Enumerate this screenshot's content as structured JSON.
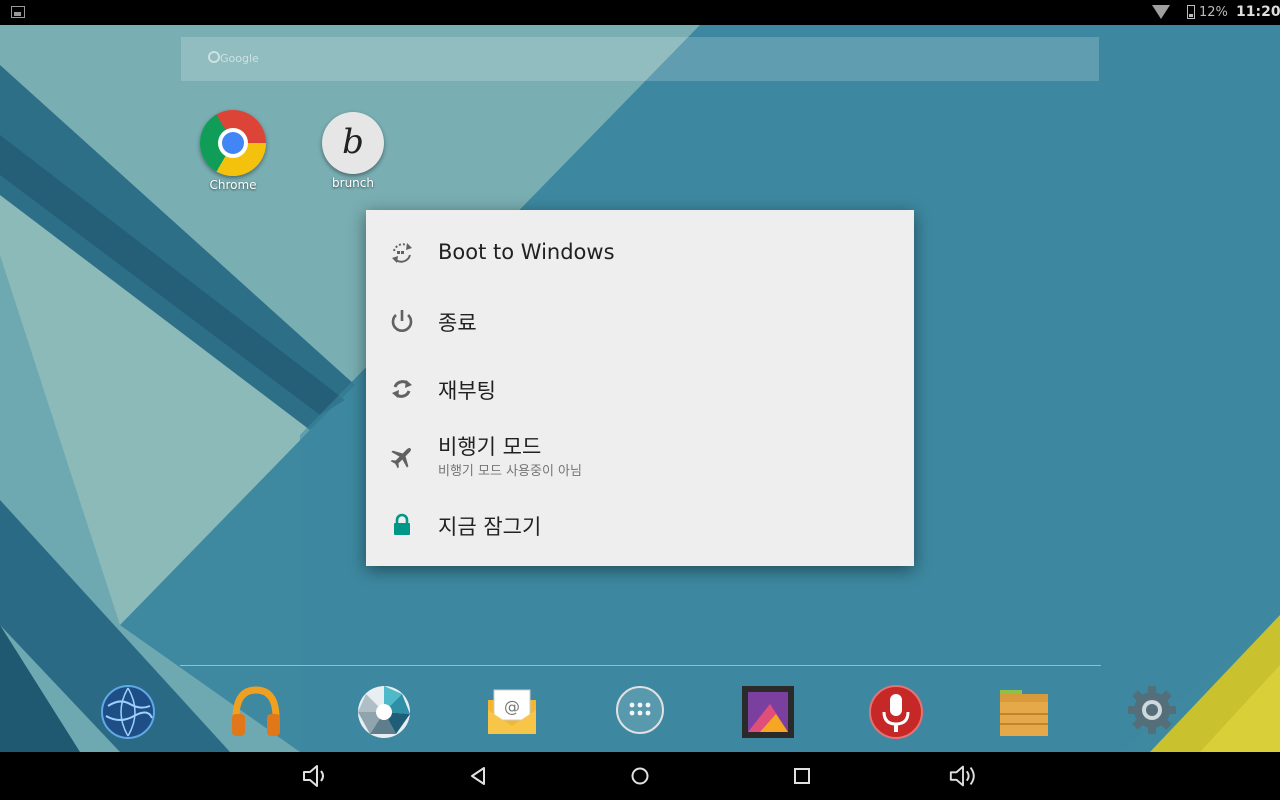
{
  "status_bar": {
    "battery_percent": "12%",
    "time": "11:20"
  },
  "search": {
    "placeholder": "Google"
  },
  "desktop_apps": [
    {
      "label": "Chrome",
      "icon": "chrome-icon"
    },
    {
      "label": "brunch",
      "icon": "brunch-icon"
    }
  ],
  "power_menu": {
    "items": [
      {
        "title": "Boot to Windows",
        "icon": "boot-windows-icon"
      },
      {
        "title": "종료",
        "icon": "power-icon"
      },
      {
        "title": "재부팅",
        "icon": "reboot-icon"
      },
      {
        "title": "비행기 모드",
        "subtitle": "비행기 모드 사용중이 아님",
        "icon": "airplane-icon"
      },
      {
        "title": "지금 잠그기",
        "icon": "lock-icon",
        "icon_color": "#009688"
      }
    ]
  },
  "dock": [
    {
      "icon": "browser-globe-icon"
    },
    {
      "icon": "music-headphones-icon"
    },
    {
      "icon": "camera-aperture-icon"
    },
    {
      "icon": "email-icon"
    },
    {
      "icon": "app-drawer-icon"
    },
    {
      "icon": "gallery-icon"
    },
    {
      "icon": "voice-recorder-icon"
    },
    {
      "icon": "file-manager-icon"
    },
    {
      "icon": "settings-gear-icon"
    }
  ],
  "nav_bar": [
    {
      "icon": "volume-down-icon"
    },
    {
      "icon": "back-icon"
    },
    {
      "icon": "home-icon"
    },
    {
      "icon": "recents-icon"
    },
    {
      "icon": "volume-up-icon"
    }
  ],
  "colors": {
    "dialog_bg": "#eeeeee",
    "accent": "#009688",
    "wallpaper": "#3f8aa1"
  }
}
